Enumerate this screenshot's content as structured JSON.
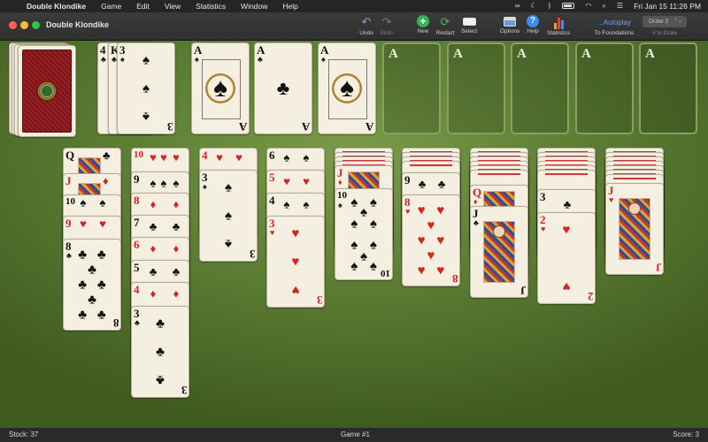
{
  "menubar": {
    "apple": "",
    "app_name": "Double Klondike",
    "menus": [
      "Game",
      "Edit",
      "View",
      "Statistics",
      "Window",
      "Help"
    ],
    "status_icons": [
      "creative-cloud-icon",
      "moon-icon",
      "bluetooth-icon",
      "battery-icon",
      "wifi-icon",
      "search-icon",
      "control-center-icon"
    ],
    "clock": "Fri Jan 15  11:26 PM"
  },
  "window": {
    "title": "Double Klondike"
  },
  "toolbar": {
    "undo": "Undo",
    "redo": "Redo",
    "new": "New",
    "restart": "Restart",
    "select": "Select",
    "options": "Options",
    "help": "Help",
    "statistics": "Statistics",
    "autoplay_main": "...Autoplay",
    "autoplay_caption": "To Foundations",
    "draw_value": "Draw 3",
    "draw_caption": "# to Draw"
  },
  "colors": {
    "felt": "#6a8a3c",
    "card_face": "#f4efe1",
    "red_suit": "#d42424",
    "card_back": "#9b2023",
    "foundation_border": "#8a9e66"
  },
  "board": {
    "waste": [
      {
        "rank": "4",
        "suit": "♣",
        "color": "black"
      },
      {
        "rank": "K",
        "suit": "♣",
        "color": "black"
      },
      {
        "rank": "3",
        "suit": "♠",
        "color": "black"
      }
    ],
    "foundation_aces": [
      {
        "rank": "A",
        "suit": "♠",
        "color": "black"
      },
      {
        "rank": "A",
        "suit": "♣",
        "color": "black"
      },
      {
        "rank": "A",
        "suit": "♠",
        "color": "black"
      }
    ],
    "empty_foundations": [
      "A",
      "A",
      "A",
      "A",
      "A"
    ],
    "tableau": [
      [
        {
          "rank": "Q",
          "suit": "♣",
          "color": "black"
        },
        {
          "rank": "J",
          "suit": "♦",
          "color": "red"
        },
        {
          "rank": "10",
          "suit": "♠",
          "color": "black"
        },
        {
          "rank": "9",
          "suit": "♥",
          "color": "red"
        },
        {
          "rank": "8",
          "suit": "♣",
          "color": "black"
        }
      ],
      [
        {
          "rank": "10",
          "suit": "♥",
          "color": "red"
        },
        {
          "rank": "9",
          "suit": "♠",
          "color": "black"
        },
        {
          "rank": "8",
          "suit": "♦",
          "color": "red"
        },
        {
          "rank": "7",
          "suit": "♣",
          "color": "black"
        },
        {
          "rank": "6",
          "suit": "♦",
          "color": "red"
        },
        {
          "rank": "5",
          "suit": "♣",
          "color": "black"
        },
        {
          "rank": "4",
          "suit": "♦",
          "color": "red"
        },
        {
          "rank": "3",
          "suit": "♣",
          "color": "black"
        }
      ],
      [
        {
          "rank": "4",
          "suit": "♥",
          "color": "red"
        },
        {
          "rank": "3",
          "suit": "♠",
          "color": "black"
        }
      ],
      [
        {
          "rank": "6",
          "suit": "♠",
          "color": "black"
        },
        {
          "rank": "5",
          "suit": "♥",
          "color": "red"
        },
        {
          "rank": "4",
          "suit": "♠",
          "color": "black"
        },
        {
          "rank": "3",
          "suit": "♥",
          "color": "red"
        }
      ],
      [
        {
          "rank": "J",
          "suit": "♦",
          "color": "red"
        },
        {
          "rank": "10",
          "suit": "♠",
          "color": "black"
        }
      ],
      [
        {
          "rank": "9",
          "suit": "♣",
          "color": "black"
        },
        {
          "rank": "8",
          "suit": "♥",
          "color": "red"
        }
      ],
      [
        {
          "rank": "Q",
          "suit": "♦",
          "color": "red"
        },
        {
          "rank": "J",
          "suit": "♣",
          "color": "black"
        }
      ],
      [
        {
          "rank": "3",
          "suit": "♣",
          "color": "black"
        },
        {
          "rank": "2",
          "suit": "♥",
          "color": "red"
        }
      ],
      [
        {
          "rank": "J",
          "suit": "♥",
          "color": "red"
        }
      ]
    ]
  },
  "statusbar": {
    "stock": "Stock: 37",
    "game": "Game #1",
    "score": "Score: 3"
  }
}
